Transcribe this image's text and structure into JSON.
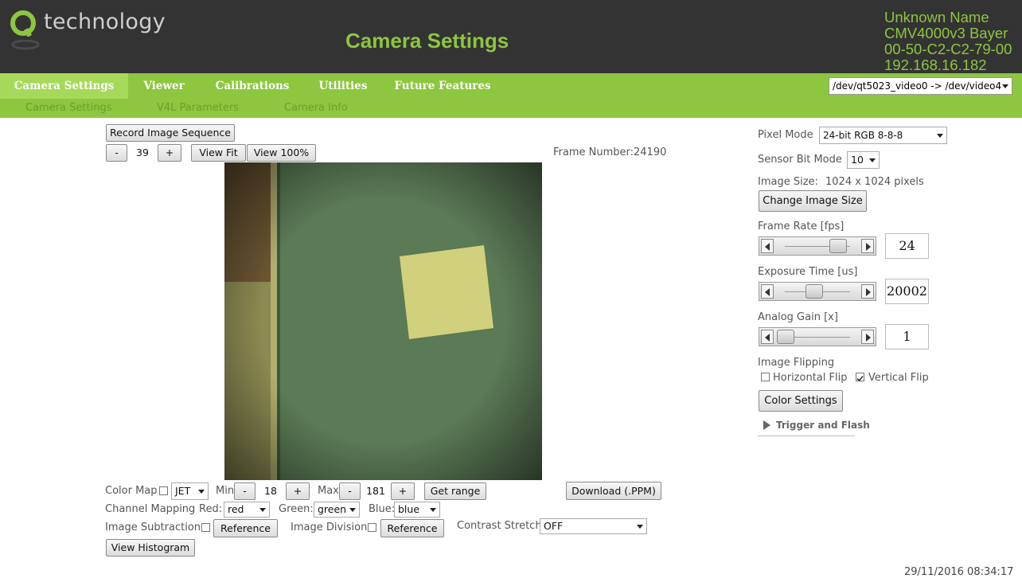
{
  "header": {
    "logo_text": "technology",
    "page_title": "Camera Settings",
    "device_name": "Unknown Name",
    "sensor": "CMV4000v3 Bayer",
    "mac": "00-50-C2-C2-79-00",
    "ip": "192.168.16.182"
  },
  "nav": {
    "tabs": [
      {
        "label": "Camera Settings"
      },
      {
        "label": "Viewer"
      },
      {
        "label": "Calibrations"
      },
      {
        "label": "Utilities"
      },
      {
        "label": "Future Features"
      }
    ],
    "device_select": "/dev/qt5023_video0 -> /dev/video4"
  },
  "subnav": {
    "tabs": [
      {
        "label": "Camera Settings"
      },
      {
        "label": "V4L Parameters"
      },
      {
        "label": "Camera Info"
      }
    ]
  },
  "viewer": {
    "record_button": "Record Image Sequence",
    "zoom_minus": "-",
    "zoom_value": "39",
    "zoom_plus": "+",
    "view_fit": "View Fit",
    "view_100": "View 100%",
    "frame_number": "Frame Number:24190"
  },
  "bottom": {
    "color_map_label": "Color Map",
    "color_map_value": "JET",
    "min_label": "Min",
    "min_minus": "-",
    "min_value": "18",
    "min_plus": "+",
    "max_label": "Max",
    "max_minus": "-",
    "max_value": "181",
    "max_plus": "+",
    "get_range": "Get range",
    "download": "Download (.PPM)",
    "channel_mapping_label": "Channel Mapping",
    "red_label": "Red:",
    "red_value": "red",
    "green_label": "Green:",
    "green_value": "green",
    "blue_label": "Blue:",
    "blue_value": "blue",
    "image_subtraction_label": "Image Subtraction",
    "reference1": "Reference",
    "image_division_label": "Image Division",
    "reference2": "Reference",
    "contrast_stretch_label": "Contrast Stretch",
    "contrast_stretch_value": "OFF",
    "view_histogram": "View Histogram"
  },
  "settings": {
    "pixel_mode_label": "Pixel Mode",
    "pixel_mode_value": "24-bit RGB 8-8-8",
    "sensor_bit_mode_label": "Sensor Bit Mode",
    "sensor_bit_mode_value": "10",
    "image_size_label": "Image Size:",
    "image_size_value": "1024 x 1024 pixels",
    "change_image_size": "Change Image Size",
    "frame_rate_label": "Frame Rate [fps]",
    "frame_rate_value": "24",
    "frame_rate_slider_fraction": 0.82,
    "exposure_label": "Exposure Time [us]",
    "exposure_value": "20002",
    "exposure_slider_fraction": 0.45,
    "gain_label": "Analog Gain [x]",
    "gain_value": "1",
    "gain_slider_fraction": 0.0,
    "image_flipping_label": "Image Flipping",
    "horizontal_flip_label": "Horizontal Flip",
    "horizontal_flip_checked": false,
    "vertical_flip_label": "Vertical Flip",
    "vertical_flip_checked": true,
    "color_settings": "Color Settings",
    "trigger_flash": "Trigger and Flash"
  },
  "footer": {
    "timestamp": "29/11/2016 08:34:17"
  },
  "colors": {
    "header_bg": "#333333",
    "brand_green": "#8dc63f",
    "active_tab": "#a6d95a"
  }
}
